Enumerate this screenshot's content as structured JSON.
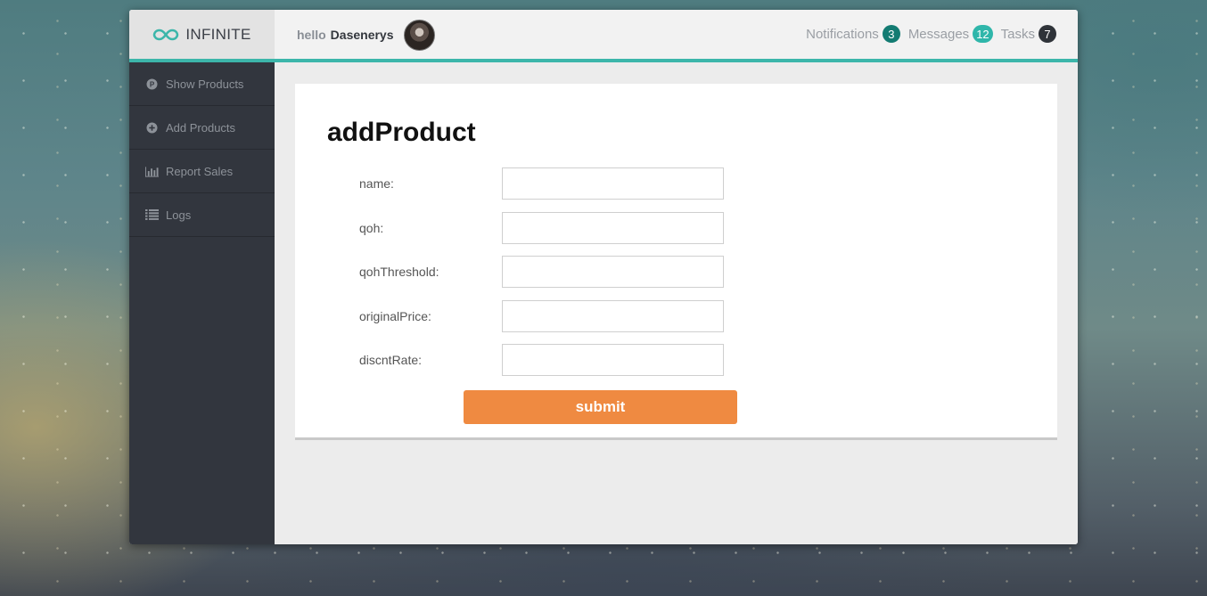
{
  "app": {
    "brand": "INFINITE",
    "accent_color": "#3cb6aa",
    "brand_icon": "infinity-icon"
  },
  "header": {
    "hello": "hello",
    "username": "Dasenerys",
    "nav": [
      {
        "label": "Notifications",
        "count": "3",
        "badge_color": "#137b72"
      },
      {
        "label": "Messages",
        "count": "12",
        "badge_color": "#2fb6aa"
      },
      {
        "label": "Tasks",
        "count": "7",
        "badge_color": "#2f3339"
      }
    ]
  },
  "sidebar": {
    "items": [
      {
        "label": "Show Products",
        "icon": "p-circle-icon"
      },
      {
        "label": "Add Products",
        "icon": "plus-circle-icon"
      },
      {
        "label": "Report Sales",
        "icon": "bar-chart-icon"
      },
      {
        "label": "Logs",
        "icon": "list-icon"
      }
    ]
  },
  "form": {
    "title": "addProduct",
    "fields": [
      {
        "label": "name:",
        "value": ""
      },
      {
        "label": "qoh:",
        "value": ""
      },
      {
        "label": "qohThreshold:",
        "value": ""
      },
      {
        "label": "originalPrice:",
        "value": ""
      },
      {
        "label": "discntRate:",
        "value": ""
      }
    ],
    "submit_label": "submit",
    "submit_color": "#ef8a41"
  }
}
